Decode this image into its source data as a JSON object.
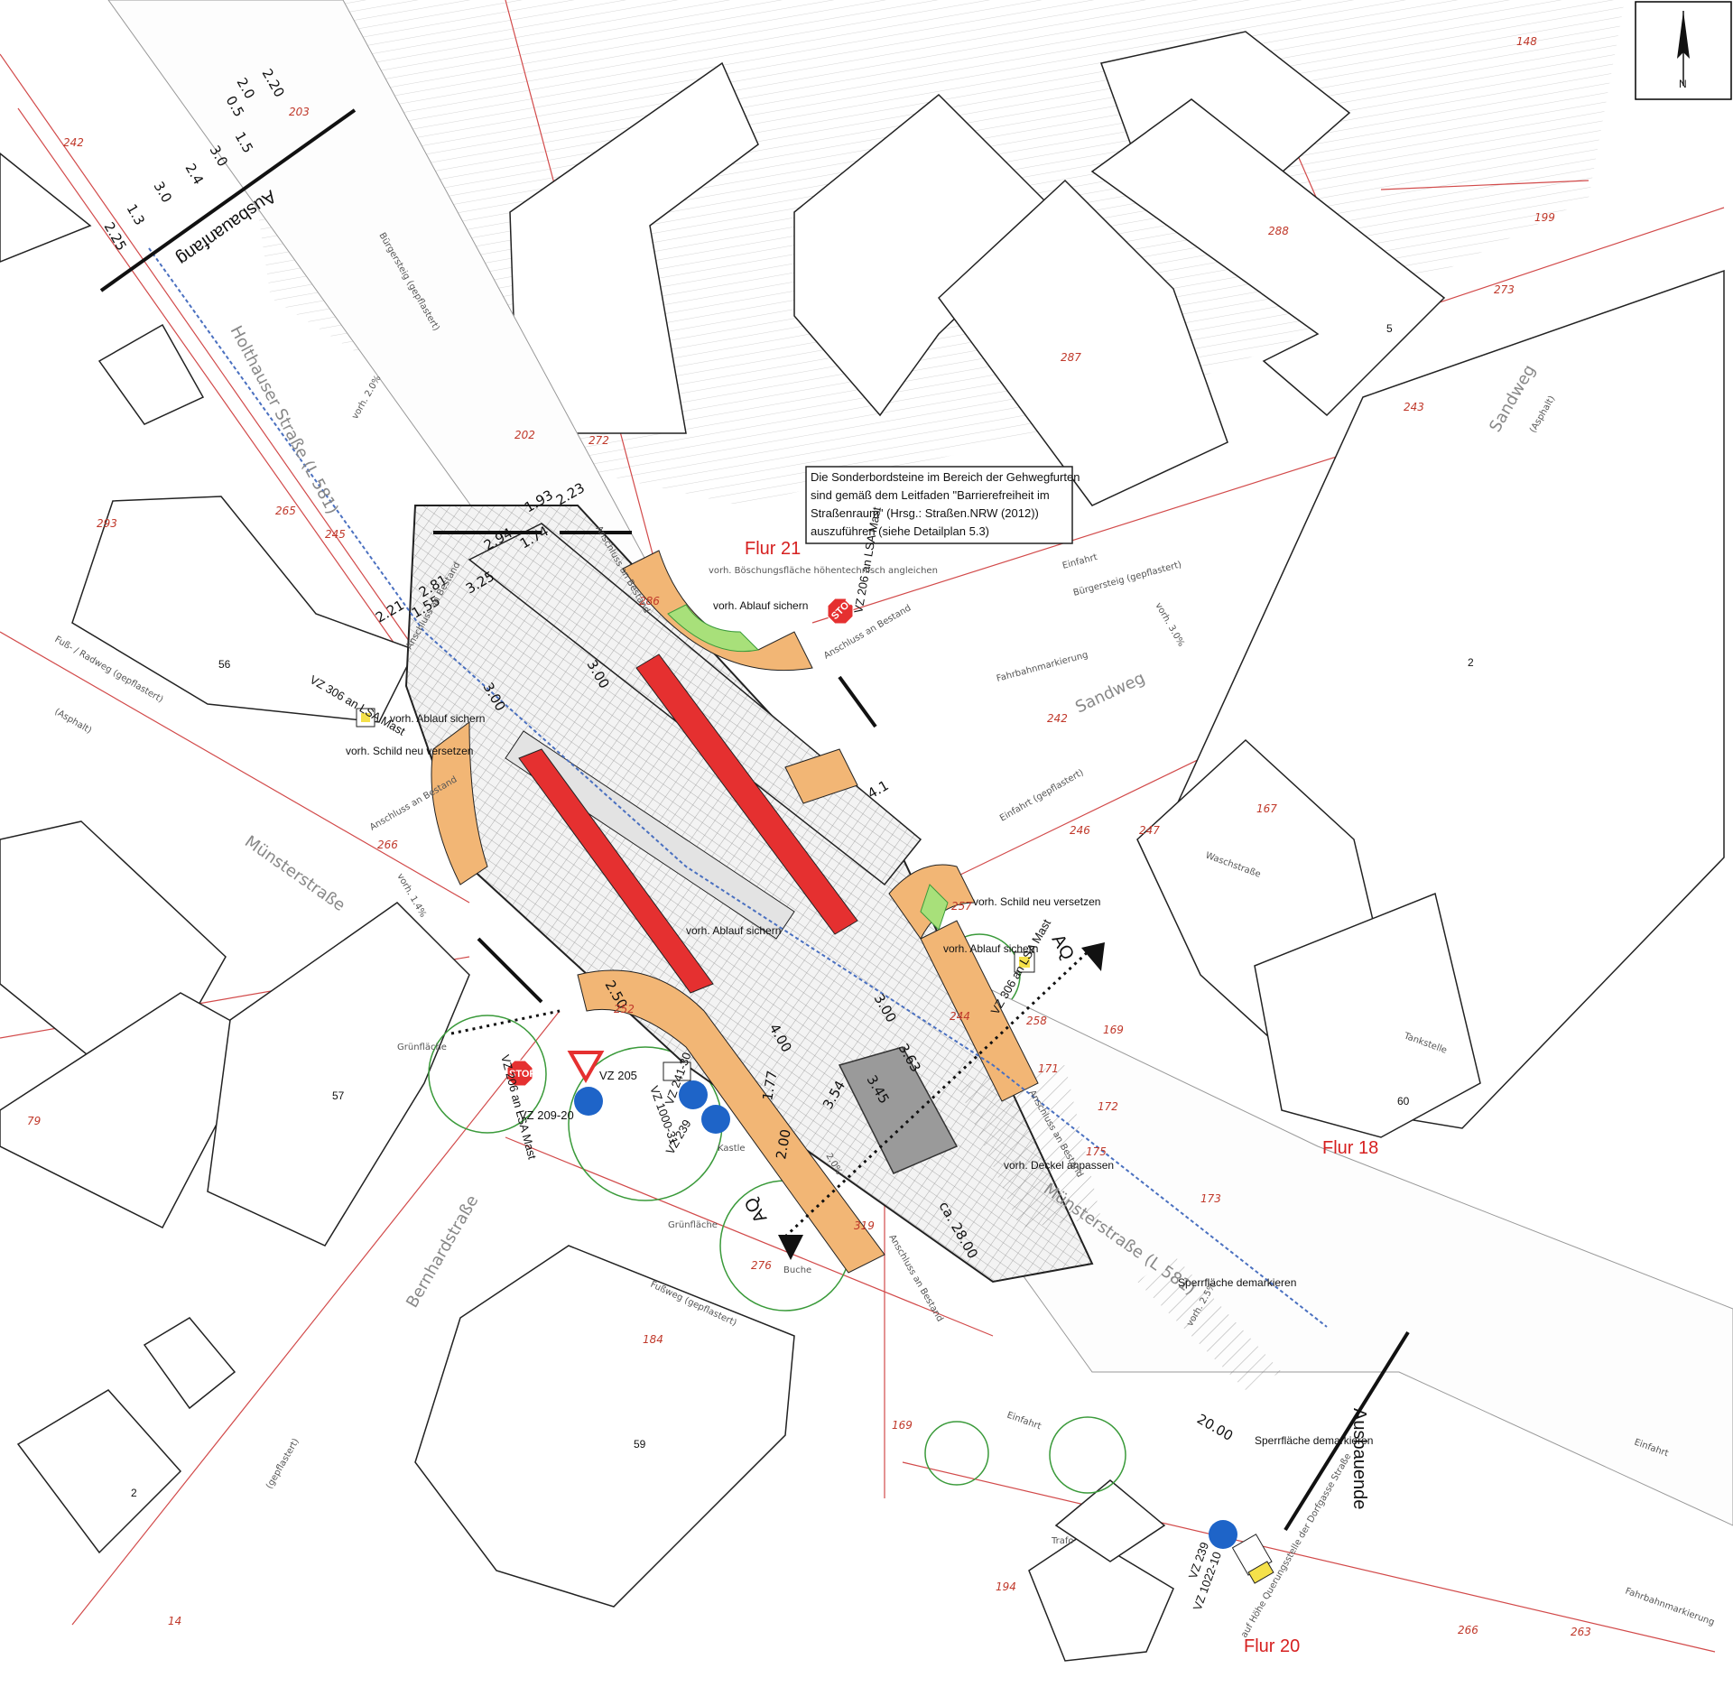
{
  "north_label": "N",
  "flurs": {
    "f21": "Flur 21",
    "f18": "Flur 18",
    "f20": "Flur 20"
  },
  "streets": {
    "holthauser": "Holthauser Straße (L 581)",
    "muenster_w": "Münsterstraße",
    "muenster_e": "Münsterstraße (L 581)",
    "sandweg_e": "Sandweg",
    "sandweg_mid": "Sandweg",
    "bernhard": "Bernhardstraße"
  },
  "markers": {
    "start": "Ausbauanfang",
    "end": "Ausbauende",
    "aq1": "AQ",
    "aq2": "AQ"
  },
  "note_box": {
    "line1": "Die Sonderbordsteine im Bereich der Gehwegfurten",
    "line2": "sind gemäß dem Leitfaden \"Barrierefreiheit im",
    "line3": "Straßenraum\" (Hrsg.: Straßen.NRW (2012))",
    "line4": "auszuführen (siehe Detailplan 5.3)"
  },
  "dimensions": {
    "d1": "2.21",
    "d2": "1.55",
    "d3": "2.81",
    "d4": "3.25",
    "d5": "2.94",
    "d6": "1.74",
    "d7": "1.93",
    "d8": "2.23",
    "d9": "3.00",
    "d10": "3.00",
    "d11": "4.1",
    "d12": "3.00",
    "d13": "4.00",
    "d14": "1.77",
    "d15": "2.00",
    "d16": "3.54",
    "d17": "3.45",
    "d18": "3.63",
    "d19": "ca. 28.00",
    "d20": "20.00",
    "d21": "2.50",
    "t1": "2.20",
    "t2": "2.0",
    "t3": "0.5",
    "t4": "1.5",
    "t5": "3.0",
    "t6": "2.4",
    "t7": "3.0",
    "t8": "1.3",
    "t9": "2.25"
  },
  "signs": {
    "vz306_nw": "VZ 306 an LSA Mast",
    "vz206_ne": "VZ 206 an LSA Mast",
    "stop": "STOP",
    "vz306_e": "VZ 306 an LSA Mast",
    "vz206_sw": "VZ 206 an LSA Mast",
    "vz205": "VZ 205",
    "vz209": "VZ 209-20",
    "vz1000": "VZ 1000-31",
    "vz241": "VZ 241-30",
    "vz239a": "VZ 239",
    "vz239b": "VZ 239",
    "vz1022": "VZ 1022-10"
  },
  "labels": {
    "abl_nw": "vorh. Ablauf sichern",
    "schild_nw": "vorh. Schild neu versetzen",
    "anschl_nw": "Anschluss an Bestand",
    "anschl_w": "Anschluss an Bestand",
    "anschl_n": "Anschluss an Bestand",
    "abl_n": "vorh. Ablauf sichern",
    "bosch": "vorh. Böschungsfläche höhentechnisch angleichen",
    "anschl_ne": "Anschluss an Bestand",
    "schild_e": "vorh. Schild neu versetzen",
    "abl_e": "vorh. Ablauf sichern",
    "abl_c": "vorh. Ablauf sichern",
    "deckel": "vorh. Deckel anpassen",
    "anschl_se": "Anschluss an Bestand",
    "anschl_s": "Anschluss an Bestand",
    "sperr1": "Sperrfläche demarkieren",
    "sperr2": "Sperrfläche demarkieren",
    "quer": "auf Höhe Querungsstelle der Dorfgasse Straße",
    "kastle": "Kastle",
    "gruen1": "Grünfläche",
    "gruen2": "Grünfläche",
    "trafo": "Trafo",
    "buerger_n": "Bürgersteig (gepflastert)",
    "buerger_e": "Bürgersteig (gepflastert)",
    "einfahrt_ne": "Einfahrt",
    "einfahrt_e": "Einfahrt (gepflastert)",
    "einfahrt_se": "Einfahrt",
    "einfahrt_s": "Einfahrt",
    "fussweg": "Fuß- / Radweg (gepflastert)",
    "fussweg_s": "Fußweg (gepflastert)",
    "asphalt": "(Asphalt)",
    "sandweg_asph": "(Asphalt)",
    "gepflastert_sw": "(gepflastert)",
    "gefaelle1": "vorh. 3.0%",
    "gefaelle2": "vorh. 1.4%",
    "gefaelle3": "vorh. 2.0%",
    "gefaelle4": "2.0%",
    "gefaelle5": "vorh. 2.5%",
    "rinne": "Fahrbahnmarkierung",
    "rinne2": "Fahrbahnmarkierung",
    "tankstelle": "Tankstelle",
    "waschstr": "Waschstraße",
    "buche": "Buche"
  },
  "parcels": {
    "p148": "148",
    "p199": "199",
    "p288": "288",
    "p273": "273",
    "p287": "287",
    "p243": "243",
    "p203": "203",
    "p242a": "242",
    "p202": "202",
    "p272": "272",
    "p293": "293",
    "p265": "265",
    "p245": "245",
    "p286": "286",
    "p242b": "242",
    "p246": "246",
    "p247": "247",
    "p167": "167",
    "p266a": "266",
    "p257": "257",
    "p244": "244",
    "p258": "258",
    "p171": "171",
    "p169a": "169",
    "p172": "172",
    "p175": "175",
    "p173": "173",
    "p79": "79",
    "p14": "14",
    "p184": "184",
    "p276": "276",
    "p319": "319",
    "p169b": "169",
    "p194": "194",
    "p266b": "266",
    "p263": "263",
    "p252": "252"
  },
  "houses": {
    "h56": "56",
    "h57": "57",
    "h2a": "2",
    "h5": "5",
    "h2b": "2",
    "h60": "60",
    "h59": "59"
  }
}
